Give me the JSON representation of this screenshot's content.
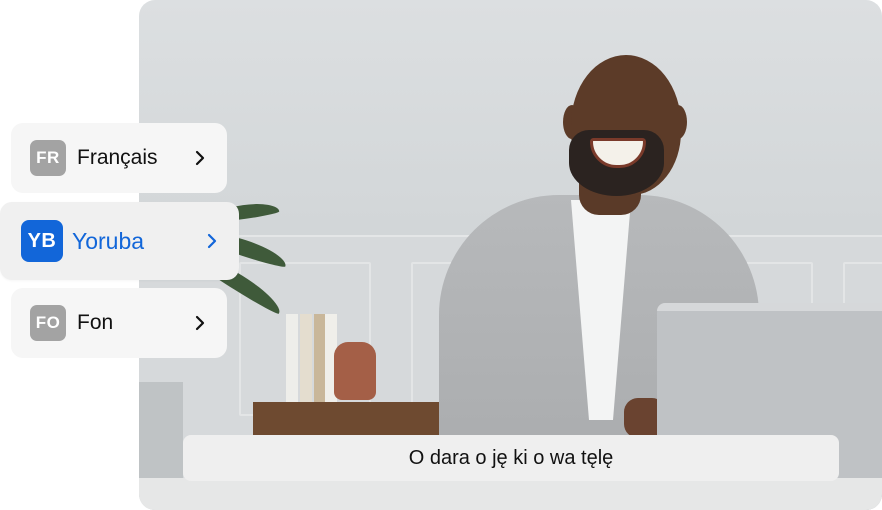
{
  "languages": [
    {
      "code": "FR",
      "label": "Français",
      "selected": false
    },
    {
      "code": "YB",
      "label": "Yoruba",
      "selected": true
    },
    {
      "code": "FO",
      "label": "Fon",
      "selected": false
    }
  ],
  "caption": {
    "text": "O dara o ję ki o wa tęlę"
  },
  "colors": {
    "accent": "#1266d9",
    "badge_inactive": "#a3a3a3",
    "card_bg": "#f6f6f6"
  },
  "icons": {
    "chevron": "chevron-right-icon"
  }
}
